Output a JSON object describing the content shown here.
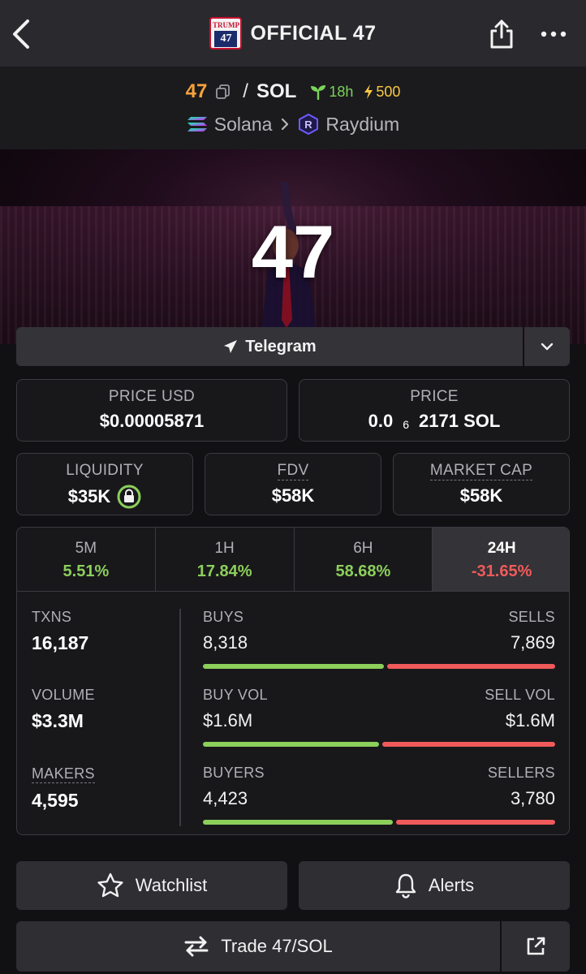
{
  "header": {
    "title": "OFFICIAL 47",
    "logo_text_top": "TRUMP",
    "logo_text_mid": "47",
    "back_icon": "chevron-left-icon",
    "share_icon": "share-icon",
    "more_icon": "more-horizontal-icon"
  },
  "pair": {
    "base": "47",
    "separator": "/",
    "quote": "SOL",
    "age": "18h",
    "boost": "500",
    "chain": "Solana",
    "dex": "Raydium"
  },
  "banner": {
    "symbol": "47"
  },
  "socials": {
    "telegram_label": "Telegram"
  },
  "stats": {
    "price_usd_label": "PRICE USD",
    "price_usd_value": "$0.00005871",
    "price_label": "PRICE",
    "price_prefix": "0.0",
    "price_subscript": "6",
    "price_suffix": "2171 SOL",
    "liquidity_label": "LIQUIDITY",
    "liquidity_value": "$35K",
    "fdv_label": "FDV",
    "fdv_value": "$58K",
    "mcap_label": "MARKET CAP",
    "mcap_value": "$58K"
  },
  "periods": [
    {
      "label": "5M",
      "change": "5.51%"
    },
    {
      "label": "1H",
      "change": "17.84%"
    },
    {
      "label": "6H",
      "change": "58.68%"
    },
    {
      "label": "24H",
      "change": "-31.65%"
    }
  ],
  "txn_stats": {
    "txns_label": "TXNS",
    "txns_value": "16,187",
    "volume_label": "VOLUME",
    "volume_value": "$3.3M",
    "makers_label": "MAKERS",
    "makers_value": "4,595",
    "buys_label": "BUYS",
    "buys_value": "8,318",
    "sells_label": "SELLS",
    "sells_value": "7,869",
    "buy_vol_label": "BUY VOL",
    "buy_vol_value": "$1.6M",
    "sell_vol_label": "SELL VOL",
    "sell_vol_value": "$1.6M",
    "buyers_label": "BUYERS",
    "buyers_value": "4,423",
    "sellers_label": "SELLERS",
    "sellers_value": "3,780",
    "buys_fraction": 0.514,
    "buy_vol_fraction": 0.5,
    "buyers_fraction": 0.539
  },
  "actions": {
    "watchlist_label": "Watchlist",
    "alerts_label": "Alerts",
    "trade_label": "Trade 47/SOL"
  },
  "colors": {
    "positive": "#8ccf5a",
    "negative": "#f05a5a",
    "base_token": "#f7a23b"
  }
}
